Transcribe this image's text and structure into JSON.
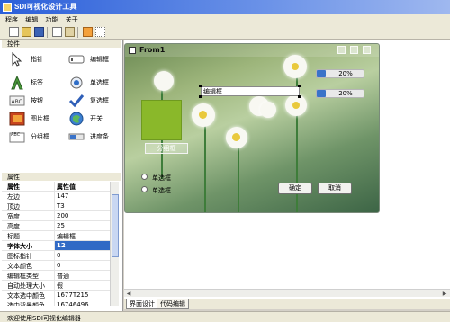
{
  "window": {
    "title": "SDI可视化设计工具"
  },
  "menu": [
    "程序",
    "编辑",
    "功能",
    "关于"
  ],
  "toolbar": {
    "icons": [
      "new-file-icon",
      "open-folder-icon",
      "save-icon",
      "copy-icon",
      "paste-icon",
      "align-icon",
      "grid-icon"
    ]
  },
  "controls_panel": {
    "title": "控件",
    "items": [
      {
        "label": "指针",
        "icon": "pointer-icon"
      },
      {
        "label": "编辑框",
        "icon": "edit-box-icon"
      },
      {
        "label": "标签",
        "icon": "label-icon"
      },
      {
        "label": "单选框",
        "icon": "radio-icon"
      },
      {
        "label": "按钮",
        "icon": "button-icon"
      },
      {
        "label": "复选框",
        "icon": "checkbox-icon"
      },
      {
        "label": "图片框",
        "icon": "picture-icon"
      },
      {
        "label": "开关",
        "icon": "switch-icon"
      },
      {
        "label": "分组框",
        "icon": "group-box-icon"
      },
      {
        "label": "进度条",
        "icon": "progress-icon"
      }
    ]
  },
  "properties_panel": {
    "title": "属性",
    "header": {
      "key": "属性",
      "value": "属性值"
    },
    "rows": [
      {
        "key": "左边",
        "value": "147"
      },
      {
        "key": "顶边",
        "value": "T3"
      },
      {
        "key": "宽度",
        "value": "200"
      },
      {
        "key": "高度",
        "value": "25"
      },
      {
        "key": "标题",
        "value": "编辑框"
      },
      {
        "key": "字体大小",
        "value": "12",
        "selected": true,
        "bold": true
      },
      {
        "key": "图标指针",
        "value": "0"
      },
      {
        "key": "文本颜色",
        "value": "0"
      },
      {
        "key": "编辑框类型",
        "value": "普通"
      },
      {
        "key": "自动处理大小",
        "value": "假"
      },
      {
        "key": "文本选中颜色",
        "value": "1677T215"
      },
      {
        "key": "选中背景颜色",
        "value": "16746496"
      }
    ]
  },
  "form": {
    "title": "From1",
    "edit_text": "编辑框",
    "progress": [
      {
        "label": "20%",
        "value": 0.2
      },
      {
        "label": "20%",
        "value": 0.2
      }
    ],
    "group_label": "分组框",
    "radio1": "单选框",
    "radio2": "单选框",
    "ok_button": "确定",
    "cancel_button": "取消"
  },
  "tabs": [
    "界面设计",
    "代码编辑"
  ],
  "status": "欢迎使用SDI可视化编辑器",
  "colors": {
    "titlebar": "#2b5fd9",
    "accent": "#316ac5",
    "picture_fill": "#8ab82a",
    "progress_fill": "#3a73c9"
  }
}
